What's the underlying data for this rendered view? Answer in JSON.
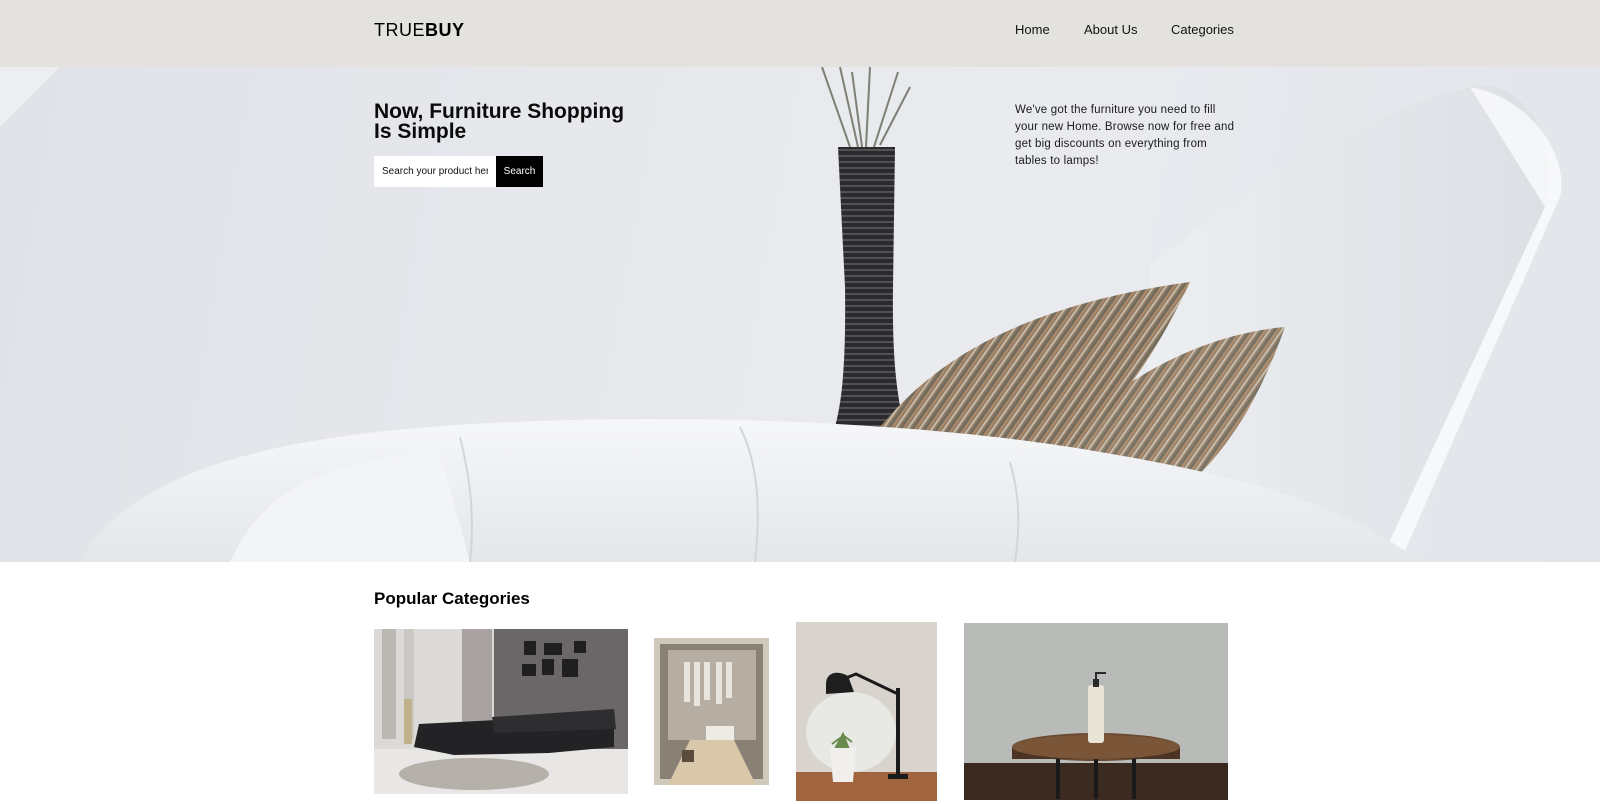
{
  "header": {
    "logo_light": "TRUE",
    "logo_bold": "BUY",
    "nav": [
      {
        "label": "Home"
      },
      {
        "label": "About Us"
      },
      {
        "label": "Categories"
      }
    ]
  },
  "hero": {
    "title": "Now, Furniture Shopping Is Simple",
    "search_placeholder": "Search your product here",
    "search_button": "Search",
    "description": "We've got the furniture you need to fill your new Home. Browse now for free and get big discounts on everything from tables to lamps!"
  },
  "categories": {
    "title": "Popular Categories"
  },
  "colors": {
    "header_bg": "#e3e2df",
    "button_bg": "#000000",
    "button_text": "#ffffff"
  }
}
